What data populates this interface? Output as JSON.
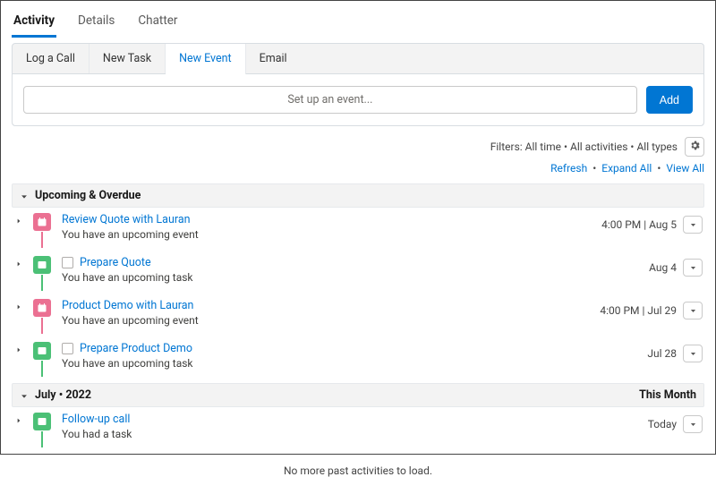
{
  "tabs": {
    "activity": "Activity",
    "details": "Details",
    "chatter": "Chatter"
  },
  "composer": {
    "tabs": {
      "log_call": "Log a Call",
      "new_task": "New Task",
      "new_event": "New Event",
      "email": "Email"
    },
    "placeholder": "Set up an event...",
    "add_label": "Add"
  },
  "filters_line": "Filters: All time • All activities • All types",
  "links": {
    "refresh": "Refresh",
    "expand_all": "Expand All",
    "view_all": "View All"
  },
  "sections": {
    "upcoming": {
      "label": "Upcoming & Overdue"
    },
    "july": {
      "label": "July",
      "year": "2022",
      "right": "This Month"
    }
  },
  "items": {
    "upcoming": [
      {
        "title": "Review Quote with Lauran",
        "sub": "You have an upcoming event",
        "date": "4:00 PM | Aug 5"
      },
      {
        "title": "Prepare Quote",
        "sub": "You have an upcoming task",
        "date": "Aug 4"
      },
      {
        "title": "Product Demo with Lauran",
        "sub": "You have an upcoming event",
        "date": "4:00 PM | Jul 29"
      },
      {
        "title": "Prepare Product Demo",
        "sub": "You have an upcoming task",
        "date": "Jul 28"
      }
    ],
    "july": [
      {
        "title": "Follow-up call",
        "sub": "You had a task",
        "date": "Today"
      }
    ]
  },
  "footer": "No more past activities to load."
}
